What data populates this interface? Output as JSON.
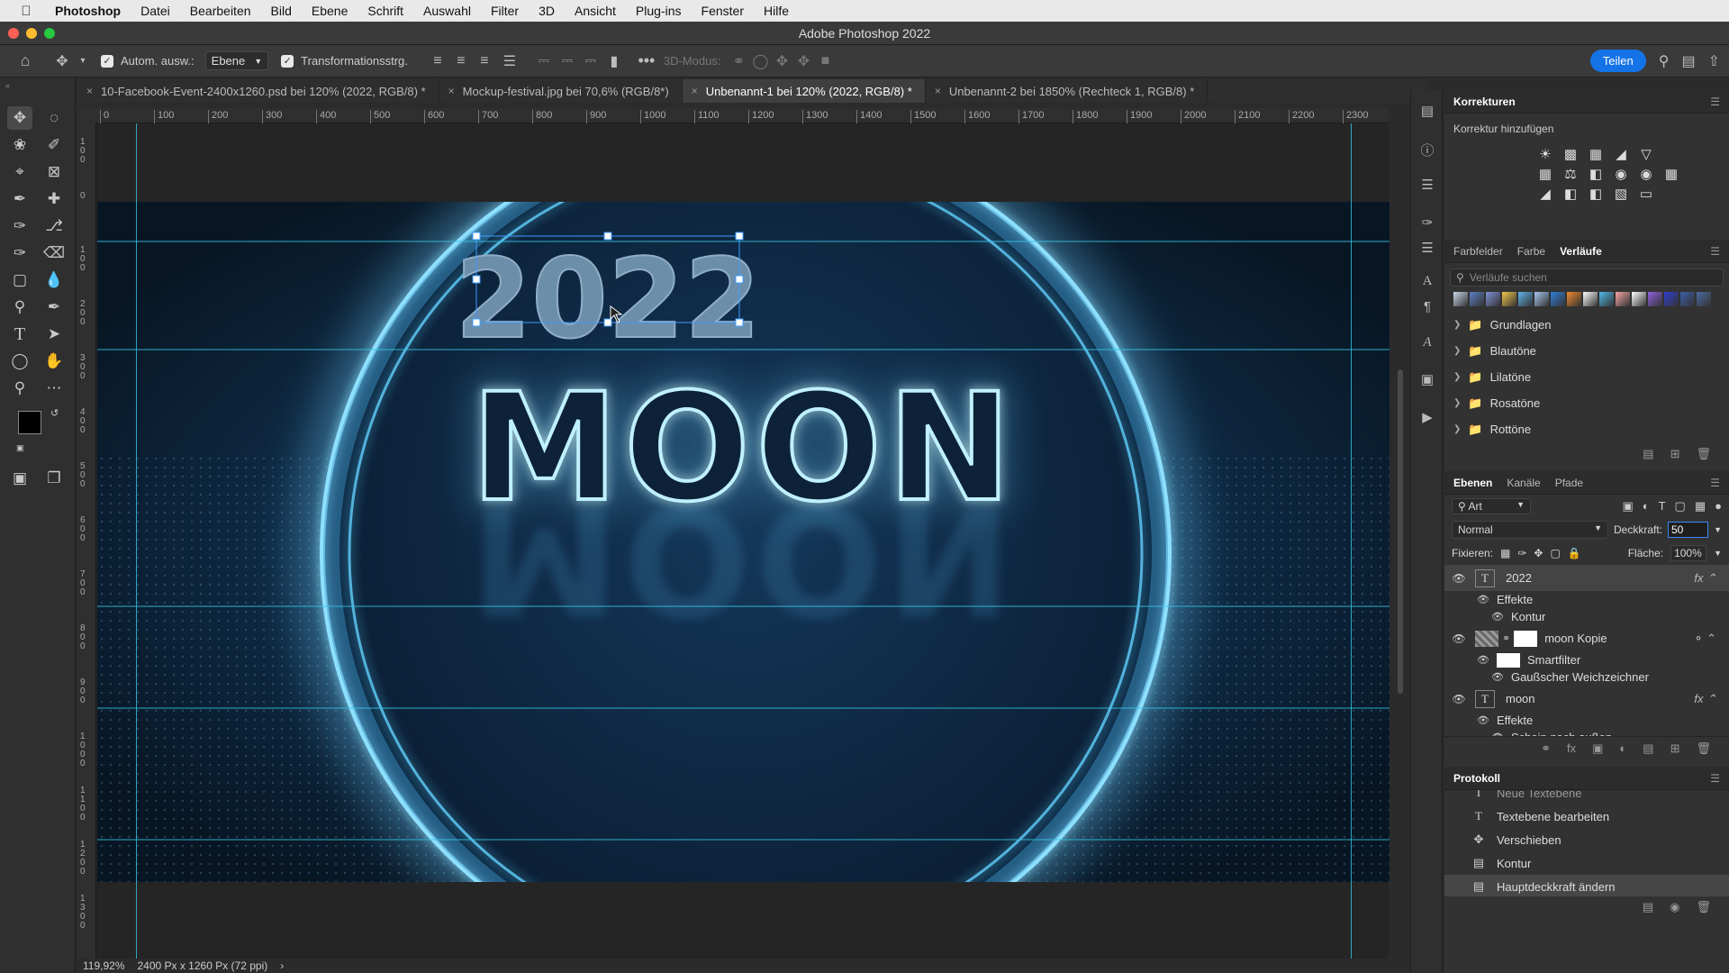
{
  "menubar": {
    "app_name": "Photoshop",
    "items": [
      "Datei",
      "Bearbeiten",
      "Bild",
      "Ebene",
      "Schrift",
      "Auswahl",
      "Filter",
      "3D",
      "Ansicht",
      "Plug-ins",
      "Fenster",
      "Hilfe"
    ]
  },
  "window": {
    "title": "Adobe Photoshop 2022"
  },
  "optionsbar": {
    "auto_select_label": "Autom. ausw.:",
    "auto_select_target": "Ebene",
    "transform_label": "Transformationsstrg.",
    "mode_3d_label": "3D-Modus:",
    "share_label": "Teilen"
  },
  "tabs": [
    {
      "label": "10-Facebook-Event-2400x1260.psd bei 120% (2022, RGB/8) *"
    },
    {
      "label": "Mockup-festival.jpg bei 70,6% (RGB/8*)"
    },
    {
      "label": "Unbenannt-1 bei 120% (2022, RGB/8) *"
    },
    {
      "label": "Unbenannt-2 bei 1850% (Rechteck 1, RGB/8) *"
    }
  ],
  "ruler": {
    "h_ticks": [
      "0",
      "100",
      "200",
      "300",
      "400",
      "500",
      "600",
      "700",
      "800",
      "900",
      "1000",
      "1100",
      "1200",
      "1300",
      "1400",
      "1500",
      "1600",
      "1700",
      "1800",
      "1900",
      "2000",
      "2100",
      "2200",
      "2300"
    ],
    "v_ticks": [
      "100",
      "0",
      "100",
      "200",
      "300",
      "400",
      "500",
      "600",
      "700",
      "800",
      "900",
      "1000",
      "1100",
      "1200",
      "1300"
    ]
  },
  "canvas": {
    "year_text": "2022",
    "title_text": "MOON"
  },
  "status": {
    "zoom": "119,92%",
    "doc_size": "2400 Px x 1260 Px (72 ppi)",
    "arrow": "›"
  },
  "panels": {
    "korrekturen": {
      "tab": "Korrekturen",
      "add_label": "Korrektur hinzufügen"
    },
    "swatch_tabs": [
      "Farbfelder",
      "Farbe",
      "Verläufe"
    ],
    "gradients": {
      "search_placeholder": "Verläufe suchen",
      "folders": [
        "Grundlagen",
        "Blautöne",
        "Lilatöne",
        "Rosatöne",
        "Rottöne"
      ],
      "swatch_colors": [
        "#c9d6e8",
        "#5b7fc4",
        "#7f8fd6",
        "#f3c64b",
        "#5fb2e8",
        "#a6c6f0",
        "#2f7fd8",
        "#f08a2e",
        "#ffffff",
        "#4fb8e8",
        "#f4a3a3",
        "#ffffff",
        "#8f5fe0",
        "#2f3fd0",
        "#3d5ea8",
        "#4a6aa0"
      ]
    },
    "layers": {
      "tabs": [
        "Ebenen",
        "Kanäle",
        "Pfade"
      ],
      "filter_label": "Art",
      "blend_mode": "Normal",
      "opacity_label": "Deckkraft:",
      "opacity_value": "50",
      "lock_label": "Fixieren:",
      "fill_label": "Fläche:",
      "fill_value": "100%",
      "items": [
        {
          "name": "2022",
          "kind": "text",
          "selected": true
        },
        {
          "name": "Effekte",
          "kind": "sub"
        },
        {
          "name": "Kontur",
          "kind": "subsub"
        },
        {
          "name": "moon Kopie",
          "kind": "smart"
        },
        {
          "name": "Smartfilter",
          "kind": "sub"
        },
        {
          "name": "Gaußscher Weichzeichner",
          "kind": "subsub"
        },
        {
          "name": "moon",
          "kind": "text"
        },
        {
          "name": "Effekte",
          "kind": "sub"
        },
        {
          "name": "Schein nach außen",
          "kind": "subsub"
        }
      ]
    },
    "protokoll": {
      "tab": "Protokoll",
      "items": [
        "Neue Textebene",
        "Textebene bearbeiten",
        "Verschieben",
        "Kontur",
        "Hauptdeckkraft ändern"
      ]
    }
  }
}
